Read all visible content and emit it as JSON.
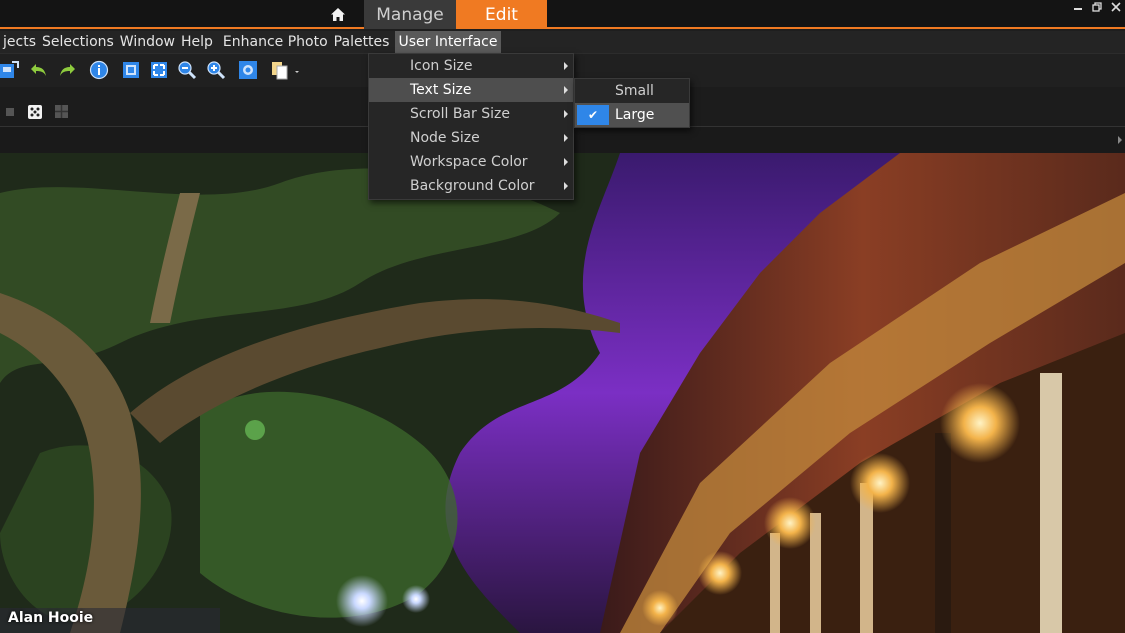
{
  "titlebar": {
    "tabs": [
      {
        "label": "Manage",
        "active": false
      },
      {
        "label": "Edit",
        "active": true
      }
    ],
    "home_icon": "home-icon",
    "window_controls": [
      "minimize-icon",
      "restore-icon",
      "close-icon"
    ],
    "accent_color": "#f07a22"
  },
  "menubar": {
    "items": [
      "jects",
      "Selections",
      "Window",
      "Help",
      "Enhance Photo",
      "Palettes",
      "User Interface"
    ],
    "active_index": 6
  },
  "toolbar": {
    "icons": [
      "save-icon",
      "undo-icon",
      "redo-icon",
      "info-icon",
      "fit-icon",
      "full-screen-icon",
      "zoom-out-icon",
      "zoom-in-icon",
      "actual-size-icon",
      "copy-icon"
    ]
  },
  "user_interface_menu": {
    "items": [
      "Icon Size",
      "Text Size",
      "Scroll Bar Size",
      "Node Size",
      "Workspace Color",
      "Background Color"
    ],
    "highlighted_index": 1
  },
  "text_size_submenu": {
    "items": [
      "Small",
      "Large"
    ],
    "checked_index": 1
  },
  "photo": {
    "watermark": "Alan Hooie"
  }
}
